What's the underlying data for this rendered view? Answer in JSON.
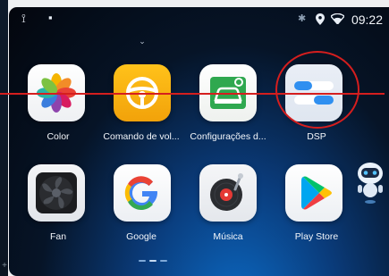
{
  "status_bar": {
    "usb_icon": "usb-icon",
    "notification_icon": "notification-icon",
    "bluetooth_icon": "bluetooth-icon",
    "location_icon": "location-icon",
    "wifi_icon": "wifi-icon",
    "time": "09:22"
  },
  "apps_row1": [
    {
      "label": "Color",
      "icon": "color-photos-icon"
    },
    {
      "label": "Comando de vol...",
      "icon": "steering-wheel-icon"
    },
    {
      "label": "Configurações d...",
      "icon": "car-settings-icon"
    },
    {
      "label": "DSP",
      "icon": "dsp-equalizer-icon"
    }
  ],
  "apps_row2": [
    {
      "label": "Fan",
      "icon": "fan-icon"
    },
    {
      "label": "Google",
      "icon": "google-icon"
    },
    {
      "label": "Música",
      "icon": "music-disc-icon"
    },
    {
      "label": "Play Store",
      "icon": "play-store-icon"
    }
  ],
  "page_indicator": {
    "pages": 3,
    "current": 2
  },
  "colors": {
    "annotation_red": "#d51e1e",
    "accent_blue": "#0c6bc6"
  }
}
